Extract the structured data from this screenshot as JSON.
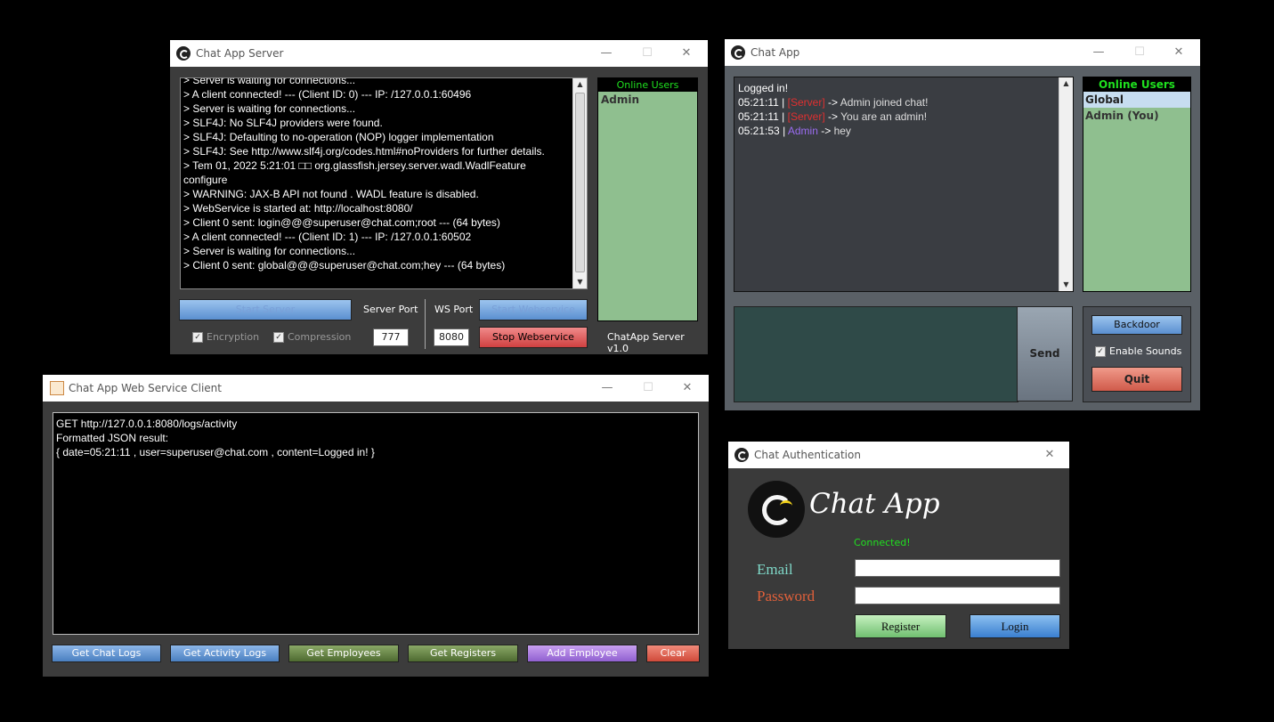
{
  "server_window": {
    "title": "Chat App Server",
    "log_lines": [
      "> Server is waiting for connections...",
      "> A client connected! --- (Client ID: 0) --- IP: /127.0.0.1:60496",
      "> Server is waiting for connections...",
      "> SLF4J: No SLF4J providers were found.",
      "> SLF4J: Defaulting to no-operation (NOP) logger implementation",
      "> SLF4J: See http://www.slf4j.org/codes.html#noProviders for further details.",
      "> Tem 01, 2022 5:21:01 □□ org.glassfish.jersey.server.wadl.WadlFeature",
      "configure",
      "> WARNING: JAX-B API not found . WADL feature is disabled.",
      "> WebService is started at: http://localhost:8080/",
      "> Client 0 sent: login@@@superuser@chat.com;root --- (64 bytes)",
      "> A client connected! --- (Client ID: 1) --- IP: /127.0.0.1:60502",
      "> Server is waiting for connections...",
      "> Client 0 sent: global@@@superuser@chat.com;hey --- (64 bytes)"
    ],
    "online_users_header": "Online Users",
    "online_users": [
      "Admin"
    ],
    "start_server_label": "Start Server",
    "server_port_label": "Server Port",
    "ws_port_label": "WS Port",
    "start_webservice_label": "Start Webservice",
    "encryption_label": "Encryption",
    "compression_label": "Compression",
    "server_port_value": "777",
    "ws_port_value": "8080",
    "stop_webservice_label": "Stop Webservice",
    "version": "ChatApp Server v1.0"
  },
  "chat_window": {
    "title": "Chat App",
    "status_line": "Logged in!",
    "messages": [
      {
        "time": "05:21:11",
        "sender": "[Server]",
        "text": "Admin joined chat!"
      },
      {
        "time": "05:21:11",
        "sender": "[Server]",
        "text": "You are an admin!"
      },
      {
        "time": "05:21:53",
        "sender": "Admin",
        "text": "hey"
      }
    ],
    "separator": "|",
    "arrow": "->",
    "online_users_header": "Online Users",
    "online_users": [
      "Global",
      "Admin (You)"
    ],
    "send_label": "Send",
    "backdoor_label": "Backdoor",
    "enable_sounds_label": "Enable Sounds",
    "quit_label": "Quit"
  },
  "webservice_window": {
    "title": "Chat App Web Service Client",
    "output_lines": [
      "GET http://127.0.0.1:8080/logs/activity",
      "Formatted JSON result:",
      "{ date=05:21:11 , user=superuser@chat.com , content=Logged in! }"
    ],
    "buttons": {
      "chat_logs": "Get Chat Logs",
      "activity_logs": "Get Activity Logs",
      "employees": "Get Employees",
      "registers": "Get Registers",
      "add_employee": "Add Employee",
      "clear": "Clear"
    }
  },
  "auth_window": {
    "title": "Chat Authentication",
    "app_name": "Chat App",
    "status": "Connected!",
    "email_label": "Email",
    "password_label": "Password",
    "email_value": "",
    "password_value": "",
    "register_label": "Register",
    "login_label": "Login"
  },
  "colors": {
    "server_red": "#e03030",
    "admin_purple": "#9a6cf0",
    "online_green": "#1fe01f",
    "panel_green": "#8fbf8f"
  }
}
